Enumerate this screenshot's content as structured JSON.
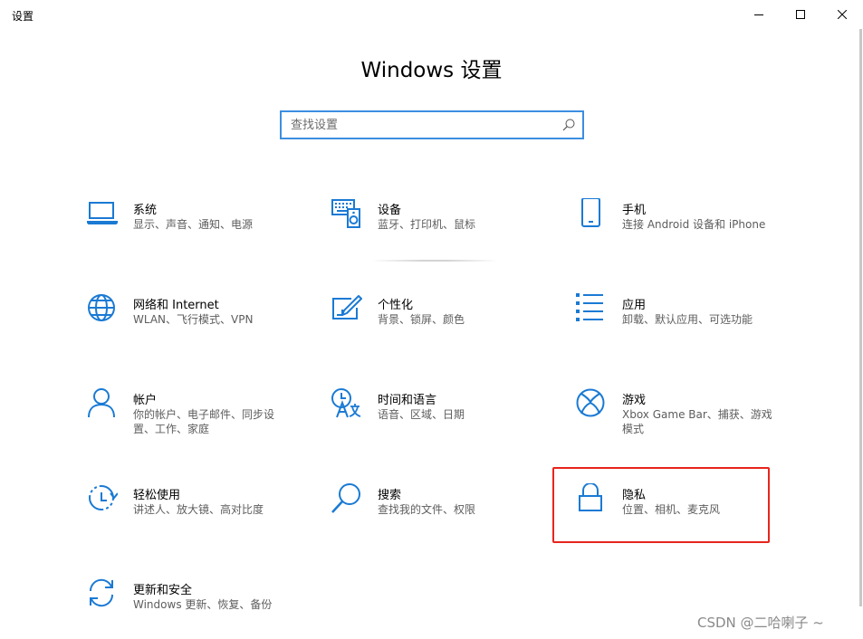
{
  "window": {
    "title": "设置"
  },
  "heading": "Windows 设置",
  "search": {
    "placeholder": "查找设置",
    "value": ""
  },
  "accent": "#1a7ad4",
  "highlight_color": "#e8241c",
  "tiles": [
    {
      "icon": "laptop-icon",
      "title": "系统",
      "desc": "显示、声音、通知、电源"
    },
    {
      "icon": "keyboard-speaker-icon",
      "title": "设备",
      "desc": "蓝牙、打印机、鼠标"
    },
    {
      "icon": "phone-icon",
      "title": "手机",
      "desc": "连接 Android 设备和 iPhone"
    },
    {
      "icon": "globe-icon",
      "title": "网络和 Internet",
      "desc": "WLAN、飞行模式、VPN"
    },
    {
      "icon": "paint-icon",
      "title": "个性化",
      "desc": "背景、锁屏、颜色"
    },
    {
      "icon": "list-icon",
      "title": "应用",
      "desc": "卸载、默认应用、可选功能"
    },
    {
      "icon": "person-icon",
      "title": "帐户",
      "desc": "你的帐户、电子邮件、同步设置、工作、家庭"
    },
    {
      "icon": "time-language-icon",
      "title": "时间和语言",
      "desc": "语音、区域、日期"
    },
    {
      "icon": "xbox-icon",
      "title": "游戏",
      "desc": "Xbox Game Bar、捕获、游戏模式"
    },
    {
      "icon": "ease-of-access-icon",
      "title": "轻松使用",
      "desc": "讲述人、放大镜、高对比度"
    },
    {
      "icon": "magnifier-icon",
      "title": "搜索",
      "desc": "查找我的文件、权限"
    },
    {
      "icon": "lock-icon",
      "title": "隐私",
      "desc": "位置、相机、麦克风"
    },
    {
      "icon": "sync-icon",
      "title": "更新和安全",
      "desc": "Windows 更新、恢复、备份"
    }
  ],
  "watermark": "CSDN @二哈喇子 ~"
}
